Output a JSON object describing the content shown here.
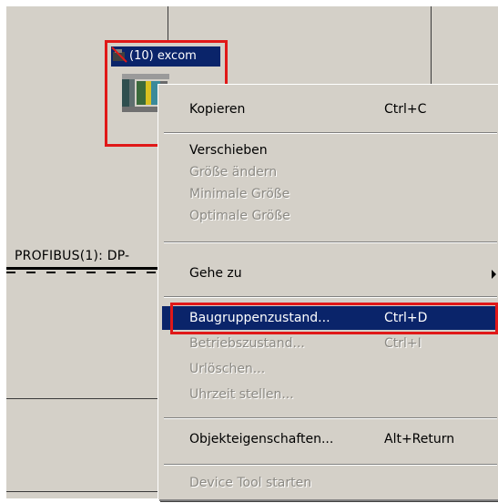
{
  "station": {
    "label": "(10) excom",
    "icon": "disabled-station-icon",
    "device_icon": "io-module-icon"
  },
  "bus": {
    "label": "PROFIBUS(1): DP-"
  },
  "context_menu": {
    "items": [
      {
        "label": "Kopieren",
        "shortcut": "Ctrl+C",
        "enabled": true
      },
      {
        "label": "Verschieben",
        "shortcut": "",
        "enabled": true
      },
      {
        "label": "Größe ändern",
        "shortcut": "",
        "enabled": false
      },
      {
        "label": "Minimale Größe",
        "shortcut": "",
        "enabled": false
      },
      {
        "label": "Optimale Größe",
        "shortcut": "",
        "enabled": false
      },
      {
        "label": "Gehe zu",
        "shortcut": "",
        "enabled": true,
        "submenu": true
      },
      {
        "label": "Baugruppenzustand...",
        "shortcut": "Ctrl+D",
        "enabled": true,
        "highlighted": true
      },
      {
        "label": "Betriebszustand...",
        "shortcut": "Ctrl+I",
        "enabled": false
      },
      {
        "label": "Urlöschen...",
        "shortcut": "",
        "enabled": false
      },
      {
        "label": "Uhrzeit stellen...",
        "shortcut": "",
        "enabled": false
      },
      {
        "label": "Objekteigenschaften...",
        "shortcut": "Alt+Return",
        "enabled": true
      },
      {
        "label": "Device Tool starten",
        "shortcut": "",
        "enabled": false
      }
    ]
  },
  "colors": {
    "highlight": "#0a246a",
    "annotation": "#e01818",
    "background": "#d4d0c8"
  }
}
